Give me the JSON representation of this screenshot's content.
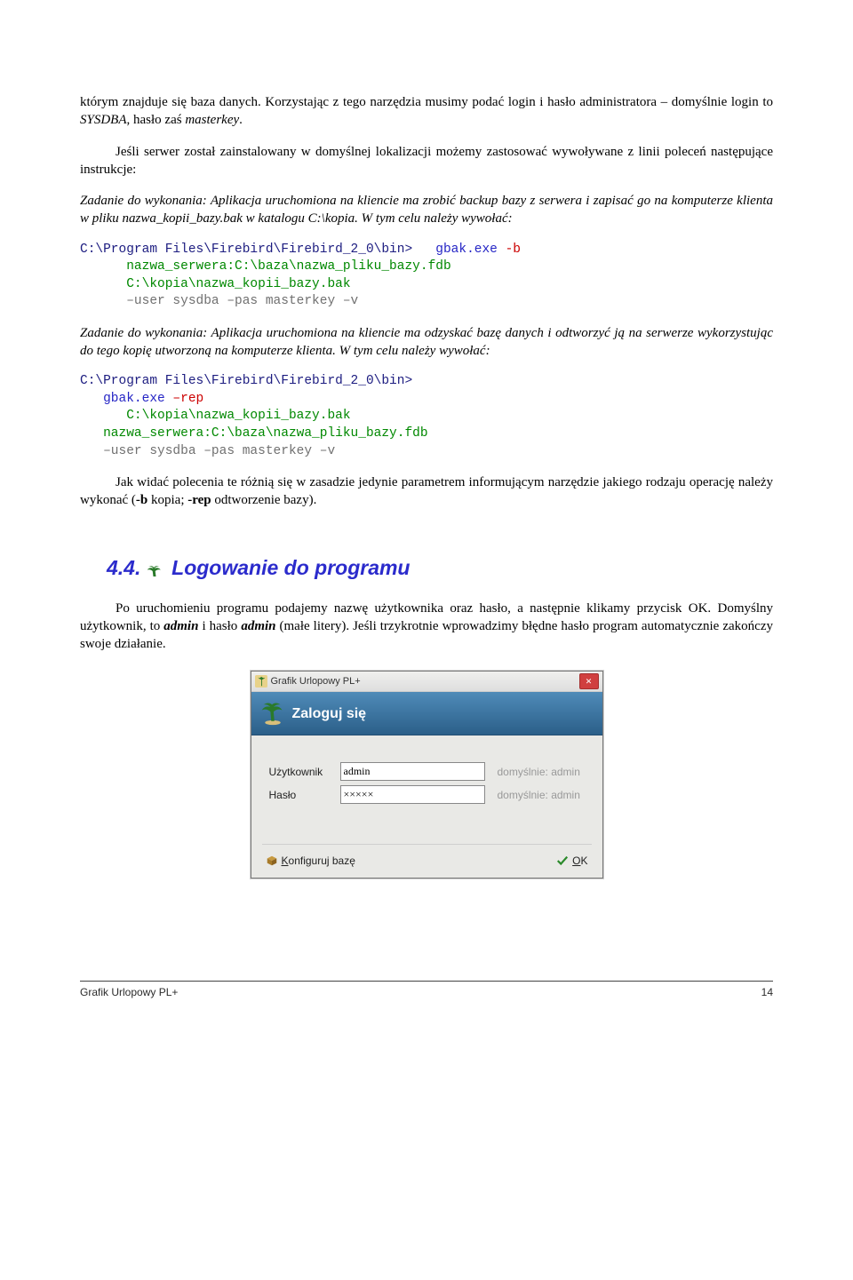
{
  "para1_runs": [
    {
      "t": "którym znajduje się baza danych. Korzystając z tego narzędzia musimy podać login i hasło administratora – domyślnie login to "
    },
    {
      "t": "SYSDBA",
      "i": true
    },
    {
      "t": ", hasło zaś "
    },
    {
      "t": "masterkey",
      "i": true
    },
    {
      "t": "."
    }
  ],
  "para2": "Jeśli serwer został zainstalowany w domyślnej lokalizacji możemy zastosować wywoływane z linii poleceń następujące instrukcje:",
  "para3_runs": [
    {
      "t": "Zadanie do wykonania: Aplikacja uruchomiona na kliencie ma zrobić backup bazy z serwera i zapisać go na komputerze klienta w pliku nazwa_kopii_bazy.bak w katalogu C:\\kopia. W tym celu należy wywołać:",
      "i": true
    }
  ],
  "code1": [
    {
      "cls": "c-navy",
      "t": "C:\\Program Files\\Firebird\\Firebird_2_0\\bin>"
    },
    {
      "cls": "c-blue",
      "t": "   gbak.exe "
    },
    {
      "cls": "c-red",
      "t": "-b"
    },
    {
      "cls": "c-green",
      "t": "\n      nazwa_serwera:C:\\baza\\nazwa_pliku_bazy.fdb\n      C:\\kopia\\nazwa_kopii_bazy.bak"
    },
    {
      "cls": "c-gray",
      "t": "\n      –user sysdba –pas masterkey –v"
    }
  ],
  "para4_runs": [
    {
      "t": "Zadanie do wykonania: Aplikacja uruchomiona na kliencie ma odzyskać bazę danych i odtworzyć ją na serwerze wykorzystując do tego kopię utworzoną na komputerze klienta. W tym celu należy wywołać:",
      "i": true
    }
  ],
  "code2": [
    {
      "cls": "c-navy",
      "t": "C:\\Program Files\\Firebird\\Firebird_2_0\\bin>"
    },
    {
      "cls": "c-blue",
      "t": "\n   gbak.exe "
    },
    {
      "cls": "c-red",
      "t": "–rep"
    },
    {
      "cls": "c-green",
      "t": "\n      C:\\kopia\\nazwa_kopii_bazy.bak"
    },
    {
      "cls": "c-blue",
      "t": "\n   "
    },
    {
      "cls": "c-green",
      "t": "nazwa_serwera:C:\\baza\\nazwa_pliku_bazy.fdb"
    },
    {
      "cls": "c-gray",
      "t": "\n   –user sysdba –pas masterkey –v"
    }
  ],
  "para5_runs": [
    {
      "t": "Jak widać polecenia te różnią się w zasadzie jedynie parametrem informującym narzędzie jakiego rodzaju operację należy wykonać ("
    },
    {
      "t": "-b",
      "b": true
    },
    {
      "t": "  kopia;   "
    },
    {
      "t": "-rep",
      "b": true
    },
    {
      "t": "  odtworzenie bazy)."
    }
  ],
  "section": {
    "num": "4.4.",
    "title": "Logowanie do programu"
  },
  "para6_runs": [
    {
      "t": "Po uruchomieniu programu podajemy nazwę użytkownika oraz hasło, a następnie klikamy przycisk OK. Domyślny użytkownik, to "
    },
    {
      "t": "admin",
      "b": true,
      "i": true
    },
    {
      "t": " i hasło "
    },
    {
      "t": "admin",
      "b": true,
      "i": true
    },
    {
      "t": " (małe litery). Jeśli trzykrotnie wprowadzimy błędne hasło program automatycznie zakończy swoje działanie."
    }
  ],
  "dialog": {
    "window_title": "Grafik Urlopowy PL+",
    "header": "Zaloguj się",
    "user_label": "Użytkownik",
    "user_value": "admin",
    "user_hint": "domyślnie: admin",
    "pass_label": "Hasło",
    "pass_value": "×××××",
    "pass_hint": "domyślnie: admin",
    "config_btn": "Konfiguruj bazę",
    "ok_btn": "OK",
    "ok_btn_plain": "K"
  },
  "footer": {
    "left": "Grafik Urlopowy PL+",
    "right": "14"
  }
}
